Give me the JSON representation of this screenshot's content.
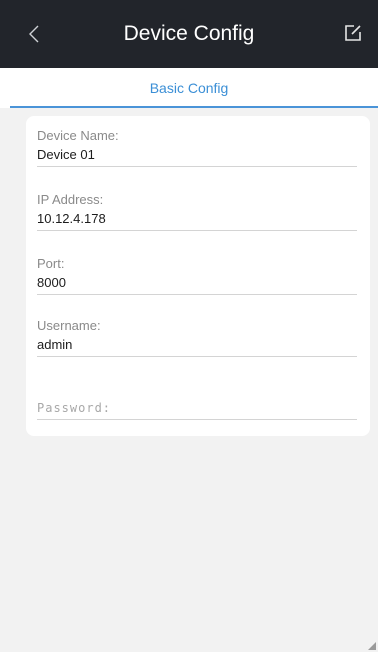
{
  "header": {
    "title": "Device Config",
    "back_icon": "chevron-left-icon",
    "edit_icon": "edit-icon"
  },
  "tabs": [
    {
      "label": "Basic Config",
      "active": true
    }
  ],
  "form": {
    "device_name": {
      "label": "Device Name:",
      "value": "Device 01"
    },
    "ip_address": {
      "label": "IP Address:",
      "value": "10.12.4.178"
    },
    "port": {
      "label": "Port:",
      "value": "8000"
    },
    "username": {
      "label": "Username:",
      "value": "admin"
    },
    "password": {
      "placeholder": "Password:",
      "value": ""
    }
  },
  "colors": {
    "header_bg": "#22252b",
    "accent": "#3b8fd6",
    "background": "#f2f2f2"
  }
}
